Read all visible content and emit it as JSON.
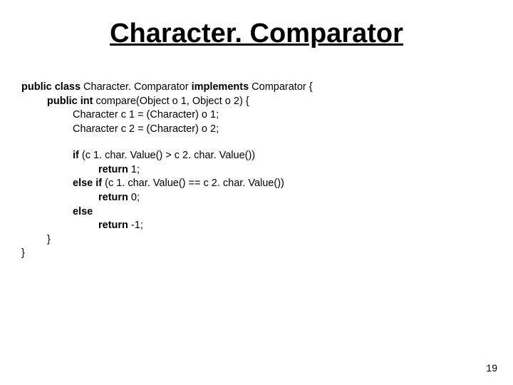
{
  "title": "Character. Comparator",
  "code": {
    "line1": {
      "kw1": "public class ",
      "name": "Character. Comparator ",
      "kw2": "implements ",
      "tail": "Comparator {"
    },
    "line2": {
      "kw": "public int ",
      "tail": "compare(Object o 1, Object o 2) {"
    },
    "line3": "Character c 1 = (Character) o 1;",
    "line4": "Character c 2 = (Character) o 2;",
    "line5": {
      "kw": "if ",
      "tail": "(c 1. char. Value() > c 2. char. Value())"
    },
    "line6": {
      "kw": "return ",
      "tail": "1;"
    },
    "line7": {
      "kw": "else if ",
      "tail": "(c 1. char. Value() == c 2. char. Value())"
    },
    "line8": {
      "kw": "return ",
      "tail": "0;"
    },
    "line9": "else",
    "line10": {
      "kw": "return ",
      "tail": "-1;"
    },
    "line11": "}",
    "line12": "}"
  },
  "page_number": "19"
}
